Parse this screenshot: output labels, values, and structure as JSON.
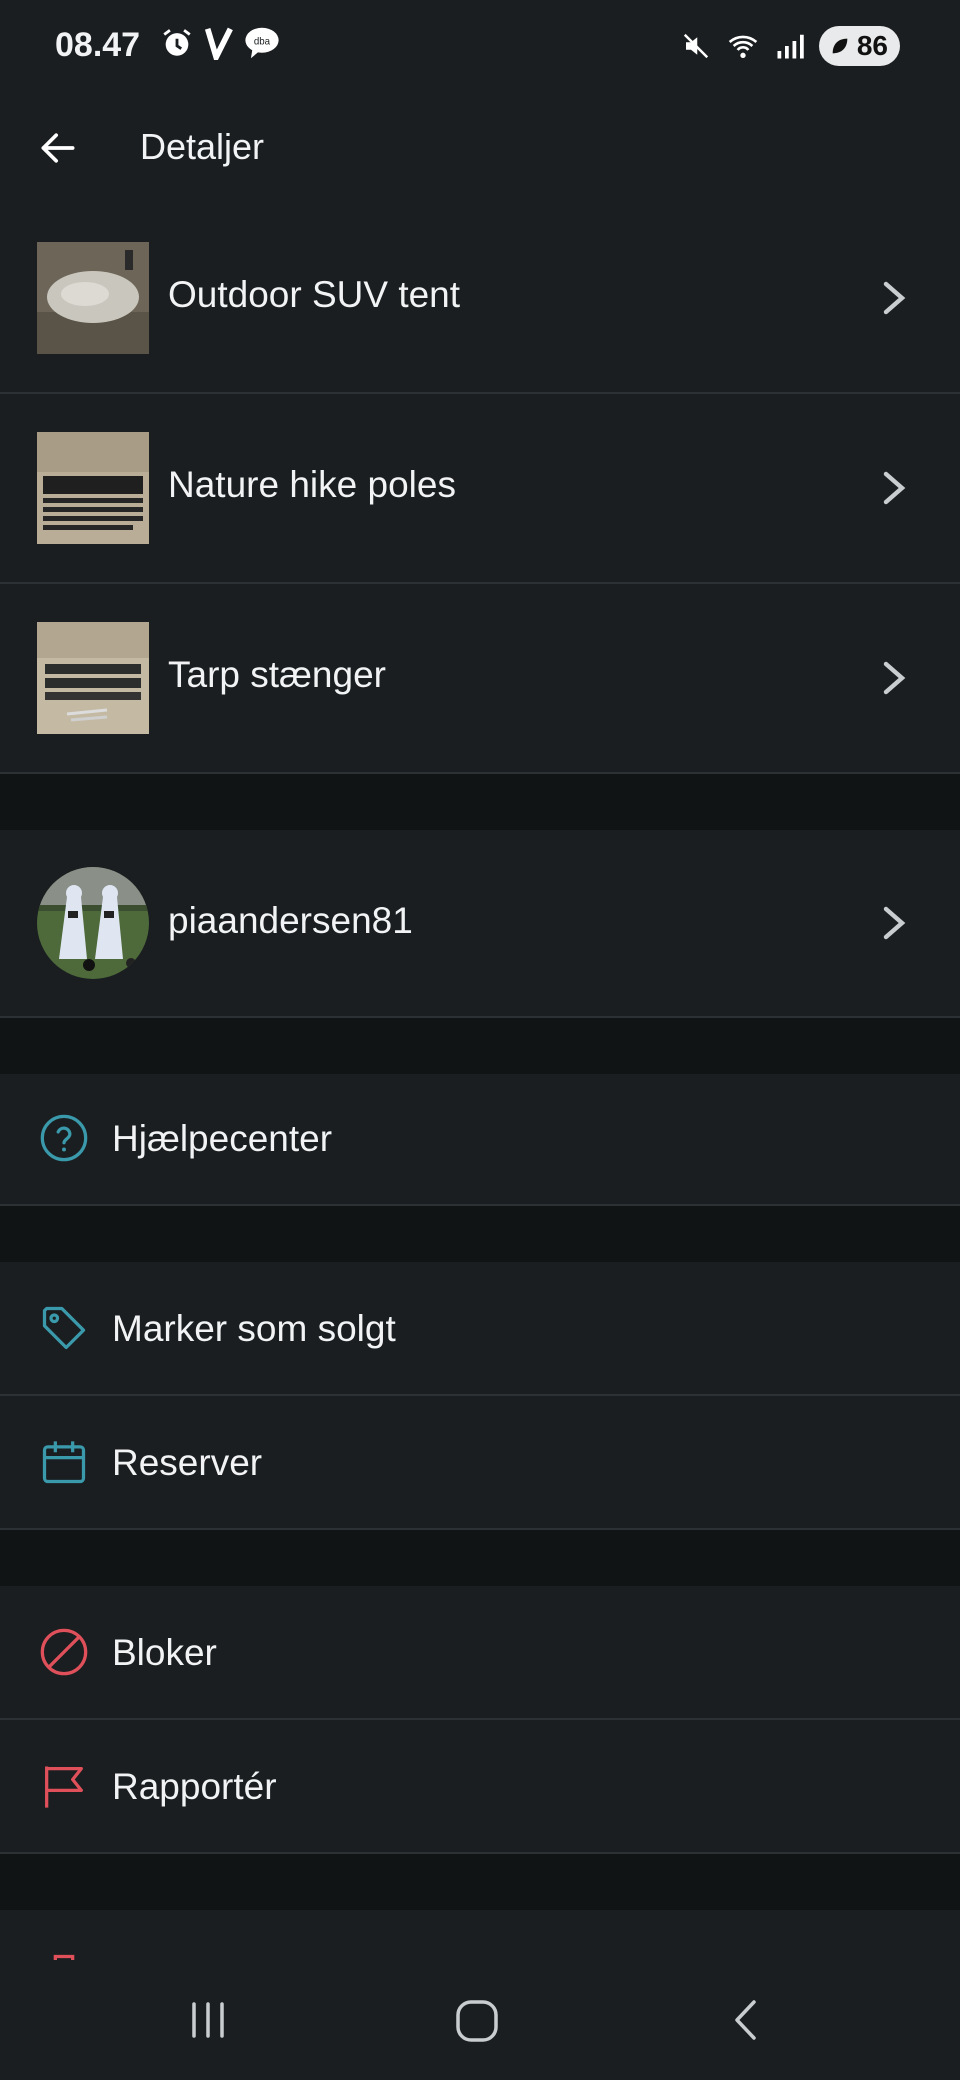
{
  "status_bar": {
    "time": "08.47",
    "icons_left": [
      "alarm-icon",
      "v-app-icon",
      "dba-chat-icon"
    ],
    "icons_right": [
      "mute-icon",
      "wifi-icon",
      "signal-icon"
    ],
    "battery": "86"
  },
  "app_bar": {
    "title": "Detaljer"
  },
  "items": [
    {
      "title": "Outdoor SUV tent"
    },
    {
      "title": "Nature hike poles"
    },
    {
      "title": "Tarp stænger"
    }
  ],
  "seller": {
    "username": "piaandersen81"
  },
  "help": {
    "label": "Hjælpecenter"
  },
  "actions": {
    "mark_sold": "Marker som solgt",
    "reserve": "Reserver",
    "block": "Bloker",
    "report": "Rapportér"
  },
  "colors": {
    "accent": "#3a9aab",
    "danger": "#e0505a",
    "background": "#1a1e20",
    "separator": "#101415"
  }
}
